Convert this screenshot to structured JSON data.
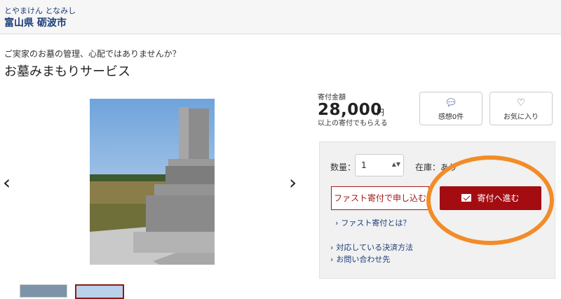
{
  "header": {
    "kana": "とやまけん となみし",
    "city": "富山県 砺波市"
  },
  "product": {
    "subtitle": "ご実家のお墓の管理、心配ではありませんか？",
    "title": "お墓みまもりサービス"
  },
  "gallery": {
    "prev": "‹",
    "next": "›"
  },
  "price": {
    "label": "寄付金額",
    "amount": "28,000",
    "unit": "円",
    "note": "以上の寄付でもらえる"
  },
  "actions": {
    "reviews_label": "感想0件",
    "favorite_label": "お気に入り"
  },
  "order": {
    "qty_label": "数量：",
    "qty_value": "1",
    "stock_label": "在庫：あり",
    "fast_button": "ファスト寄付で申し込む",
    "donate_button": "寄付へ進む"
  },
  "links": {
    "fast_info": "ファスト寄付とは？",
    "payment": "対応している決済方法",
    "contact": "お問い合わせ先"
  },
  "colors": {
    "accent": "#a30d12",
    "highlight": "#f28c28",
    "link": "#1a3c78"
  }
}
